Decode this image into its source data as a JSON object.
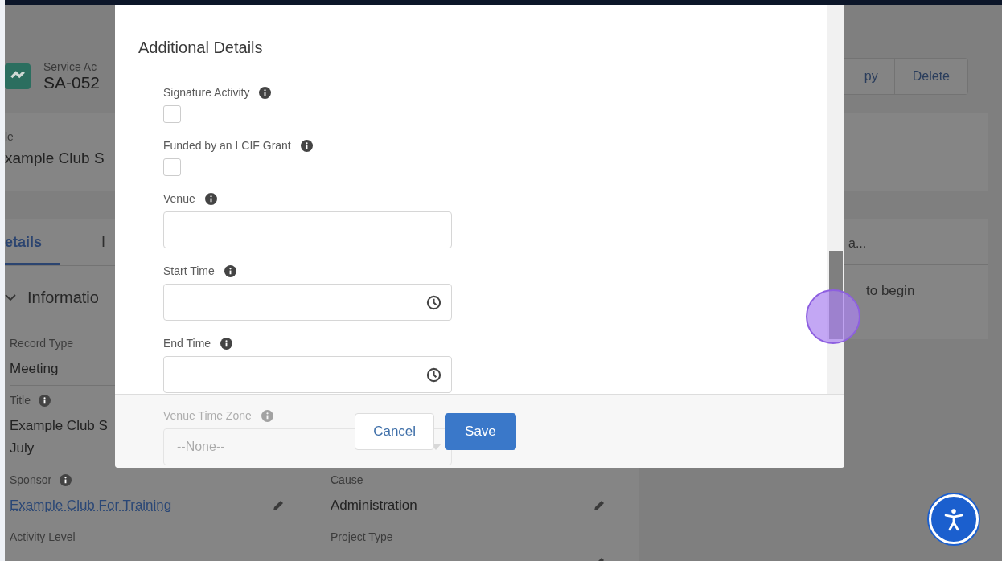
{
  "record_header": {
    "object_label": "Service Ac",
    "record_name": "SA-052",
    "buttons": [
      {
        "label": "py"
      },
      {
        "label": "Delete"
      }
    ]
  },
  "highlights": {
    "label": "le",
    "value": "xample Club S"
  },
  "tabs": [
    {
      "label": "etails",
      "selected": true
    },
    {
      "label": "I",
      "selected": false
    }
  ],
  "section": {
    "title": "Informatio",
    "expanded": true
  },
  "detail_rows": [
    {
      "left": {
        "label": "Record Type",
        "value_lines": [
          "Meeting"
        ]
      }
    },
    {
      "left": {
        "label": "Title",
        "info": true,
        "value_lines": [
          "Example Club S",
          "July"
        ]
      }
    },
    {
      "left": {
        "label": "Sponsor",
        "info": true,
        "kind": "link",
        "value_lines": [
          "Example Club For Training"
        ],
        "editable": true
      },
      "right": {
        "label": "Cause",
        "value_lines": [
          "Administration"
        ],
        "editable": true
      }
    },
    {
      "left": {
        "label": "Activity Level"
      },
      "right": {
        "label": "Project Type",
        "editable": true
      }
    }
  ],
  "activity_card": {
    "title": "a...",
    "message": "to begin"
  },
  "modal": {
    "heading": "Additional Details",
    "fields": [
      {
        "kind": "checkbox",
        "label": "Signature Activity",
        "info": true,
        "checked": false
      },
      {
        "kind": "checkbox",
        "label": "Funded by an LCIF Grant",
        "info": true,
        "checked": false
      },
      {
        "kind": "text",
        "label": "Venue",
        "info": true
      },
      {
        "kind": "time",
        "label": "Start Time",
        "info": true
      },
      {
        "kind": "time",
        "label": "End Time",
        "info": true
      },
      {
        "kind": "select",
        "label": "Venue Time Zone",
        "info": true,
        "value": "--None--"
      }
    ],
    "buttons": [
      {
        "label": "Cancel",
        "kind": "neutral"
      },
      {
        "label": "Save",
        "kind": "brand"
      }
    ]
  }
}
